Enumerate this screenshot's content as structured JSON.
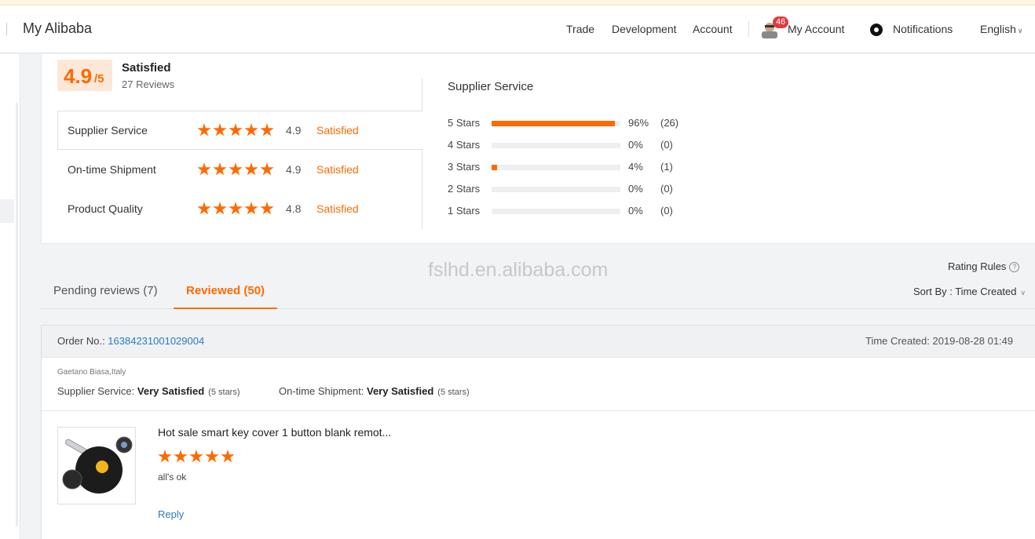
{
  "header": {
    "brand": "My Alibaba",
    "nav": [
      "Trade",
      "Development",
      "Account"
    ],
    "account_badge": "46",
    "my_account": "My Account",
    "notifications": "Notifications",
    "language": "English"
  },
  "summary": {
    "score": "4.9",
    "score_suffix": "/5",
    "level": "Satisfied",
    "reviews": "27 Reviews",
    "rows": [
      {
        "label": "Supplier Service",
        "stars": 5,
        "score": "4.9",
        "level": "Satisfied"
      },
      {
        "label": "On-time Shipment",
        "stars": 5,
        "score": "4.9",
        "level": "Satisfied"
      },
      {
        "label": "Product Quality",
        "stars": 5,
        "score": "4.8",
        "level": "Satisfied"
      }
    ]
  },
  "distribution": {
    "title": "Supplier Service",
    "rows": [
      {
        "label": "5  Stars",
        "fraction": 0.96,
        "pct": "96%",
        "count": "(26)"
      },
      {
        "label": "4  Stars",
        "fraction": 0,
        "pct": "0%",
        "count": "(0)"
      },
      {
        "label": "3  Stars",
        "fraction": 0.04,
        "pct": "4%",
        "count": "(1)"
      },
      {
        "label": "2  Stars",
        "fraction": 0,
        "pct": "0%",
        "count": "(0)"
      },
      {
        "label": "1  Stars",
        "fraction": 0,
        "pct": "0%",
        "count": "(0)"
      }
    ]
  },
  "watermark": "fslhd.en.alibaba.com",
  "rating_rules": "Rating Rules",
  "tabs": {
    "pending": "Pending reviews (7)",
    "reviewed": "Reviewed (50)"
  },
  "sort": "Sort By : Time Created",
  "order": {
    "label": "Order No.: ",
    "number": "16384231001029004",
    "time_created": "Time Created: 2019-08-28 01:49",
    "buyer": "Gaetano Biasa,Italy",
    "supplier_service_label": "Supplier Service: ",
    "supplier_service_value": "Very Satisfied",
    "supplier_service_stars": "(5 stars)",
    "shipment_label": "On-time Shipment: ",
    "shipment_value": "Very Satisfied",
    "shipment_stars": "(5 stars)",
    "product_title": "Hot sale smart key cover 1 button blank remot...",
    "product_stars": 5,
    "comment": "all's ok",
    "reply": "Reply"
  },
  "colors": {
    "accent": "#ff6a00",
    "link": "#2a7ac8"
  }
}
